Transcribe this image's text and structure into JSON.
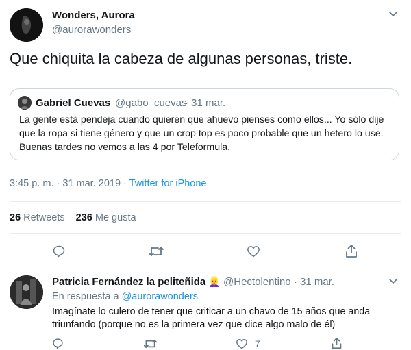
{
  "main_tweet": {
    "author_name": "Wonders, Aurora",
    "author_handle": "@aurorawonders",
    "text": "Que chiquita la cabeza de algunas personas, triste.",
    "timestamp": "3:45 p. m. · 31 mar. 2019",
    "separator": "·",
    "source": "Twitter for iPhone",
    "retweets_count": "26",
    "retweets_label": "Retweets",
    "likes_count": "236",
    "likes_label": "Me gusta"
  },
  "quoted_tweet": {
    "author_name": "Gabriel Cuevas",
    "author_handle": "@gabo_cuevas",
    "date": "· 31 mar.",
    "text": "La gente está pendeja cuando quieren que ahuevo pienses como ellos... Yo sólo dije que la ropa si tiene género y que un crop top es poco probable que un hetero lo use. Buenas tardes no vemos a las 4 por Teleformula."
  },
  "reply": {
    "author_name": "Patricia Fernández la peliteñida",
    "author_emoji": "👱‍♀️",
    "author_handle": "@Hectolentino",
    "date": "· 31 mar.",
    "replying_to_label": "En respuesta a",
    "replying_to_handle": "@aurorawonders",
    "text": "Imagínate lo culero de tener que criticar a un chavo de 15 años que anda triunfando (porque no es la primera vez que dice algo malo de él)",
    "like_count": "7"
  },
  "icons": {
    "more": "chevron-down-icon",
    "reply": "reply-icon",
    "retweet": "retweet-icon",
    "like": "heart-icon",
    "share": "share-icon"
  },
  "colors": {
    "link": "#1b95e0",
    "muted": "#657786",
    "text": "#14171a",
    "border": "#ccd6dd"
  }
}
